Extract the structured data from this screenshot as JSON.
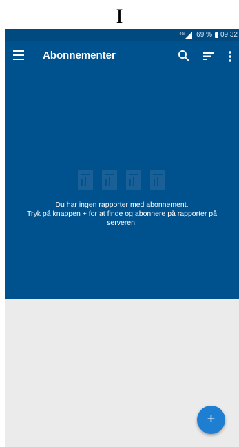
{
  "figure_label": "I",
  "status_bar": {
    "network": "4G",
    "battery": "69 %",
    "time": "09.32"
  },
  "app_bar": {
    "title": "Abonnementer",
    "icons": [
      "menu-icon",
      "search-icon",
      "sort-icon",
      "more-vert-icon"
    ]
  },
  "empty_state": {
    "line1": "Du har ingen rapporter med abonnement.",
    "line2": "Tryk på knappen + for at finde og abonnere på rapporter på",
    "line3": "serveren."
  },
  "fab": {
    "label": "+"
  },
  "colors": {
    "primary": "#00528e",
    "status": "#004a80",
    "background": "#ebebeb",
    "fab": "#1e7fd2"
  }
}
